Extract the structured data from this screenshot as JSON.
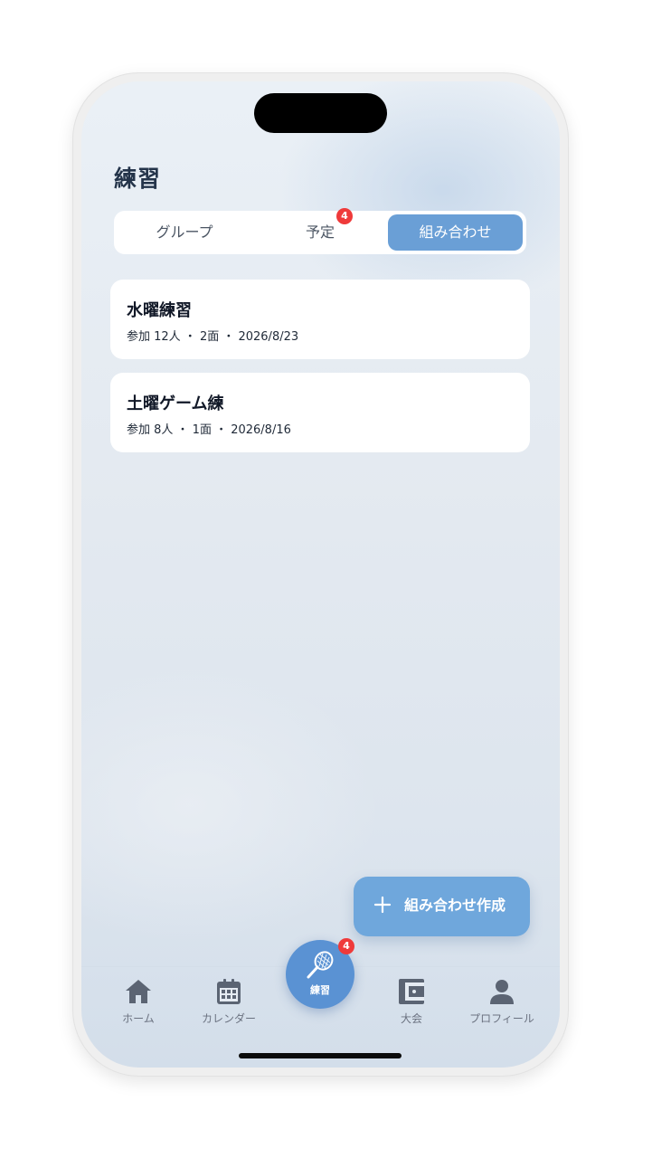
{
  "header": {
    "title": "練習"
  },
  "segments": [
    {
      "label": "グループ",
      "active": false
    },
    {
      "label": "予定",
      "active": false,
      "badge": "4"
    },
    {
      "label": "組み合わせ",
      "active": true
    }
  ],
  "cards": [
    {
      "title": "水曜練習",
      "meta": "参加 12人 ・ 2面 ・ 2026/8/23"
    },
    {
      "title": "土曜ゲーム練",
      "meta": "参加 8人 ・ 1面 ・ 2026/8/16"
    }
  ],
  "fab": {
    "icon": "plus-icon",
    "label": "組み合わせ作成"
  },
  "tabbar": {
    "home": {
      "label": "ホーム",
      "icon": "home-icon"
    },
    "calendar": {
      "label": "カレンダー",
      "icon": "calendar-icon"
    },
    "practice": {
      "label": "練習",
      "icon": "tennis-racket-icon",
      "badge": "4"
    },
    "tournament": {
      "label": "大会",
      "icon": "wallet-icon"
    },
    "profile": {
      "label": "プロフィール",
      "icon": "person-icon"
    }
  },
  "colors": {
    "accent": "#6a9fd6",
    "fab": "#6fa7dc",
    "center_button": "#5a92d3",
    "badge": "#ef3a3a",
    "title_text": "#24344a",
    "tab_icon": "#5b6473"
  }
}
